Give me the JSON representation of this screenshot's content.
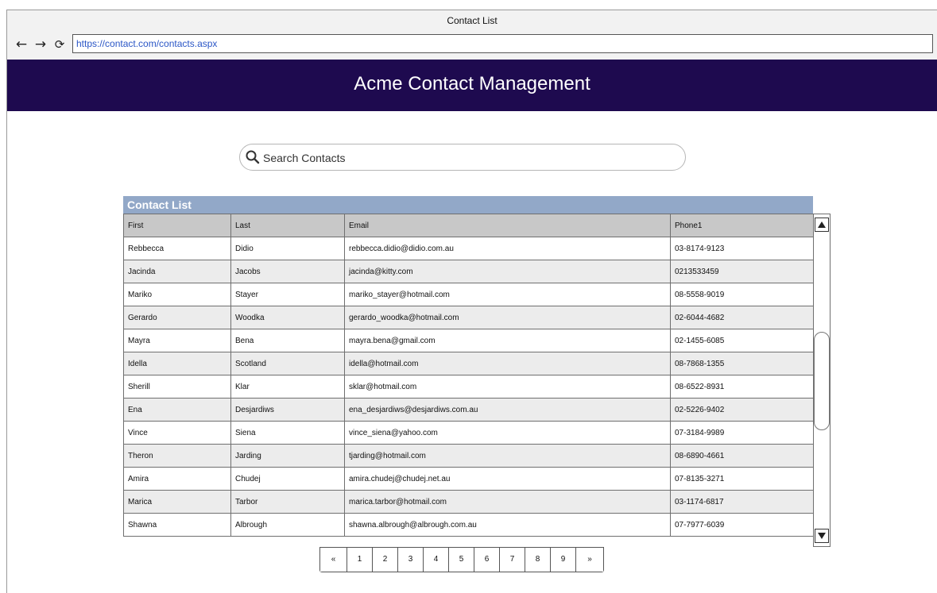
{
  "window": {
    "title": "Contact List",
    "url": "https://contact.com/contacts.aspx",
    "nav": {
      "back_icon": "back-arrow-icon",
      "forward_icon": "forward-arrow-icon",
      "reload_icon": "reload-icon"
    }
  },
  "header": {
    "title": "Acme Contact Management",
    "background": "#1e0a4f"
  },
  "search": {
    "placeholder": "Search Contacts",
    "icon": "search-icon"
  },
  "contact_list": {
    "caption": "Contact List",
    "caption_color": "#92a8c8",
    "columns": [
      "First",
      "Last",
      "Email",
      "Phone1"
    ],
    "rows": [
      [
        "Rebbecca",
        "Didio",
        "rebbecca.didio@didio.com.au",
        "03-8174-9123"
      ],
      [
        "Jacinda",
        "Jacobs",
        "jacinda@kitty.com",
        "0213533459"
      ],
      [
        "Mariko",
        "Stayer",
        "mariko_stayer@hotmail.com",
        "08-5558-9019"
      ],
      [
        "Gerardo",
        "Woodka",
        "gerardo_woodka@hotmail.com",
        "02-6044-4682"
      ],
      [
        "Mayra",
        "Bena",
        "mayra.bena@gmail.com",
        "02-1455-6085"
      ],
      [
        "Idella",
        "Scotland",
        "idella@hotmail.com",
        "08-7868-1355"
      ],
      [
        "Sherill",
        "Klar",
        "sklar@hotmail.com",
        "08-6522-8931"
      ],
      [
        "Ena",
        "Desjardiws",
        "ena_desjardiws@desjardiws.com.au",
        "02-5226-9402"
      ],
      [
        "Vince",
        "Siena",
        "vince_siena@yahoo.com",
        "07-3184-9989"
      ],
      [
        "Theron",
        "Jarding",
        "tjarding@hotmail.com",
        "08-6890-4661"
      ],
      [
        "Amira",
        "Chudej",
        "amira.chudej@chudej.net.au",
        "07-8135-3271"
      ],
      [
        "Marica",
        "Tarbor",
        "marica.tarbor@hotmail.com",
        "03-1174-6817"
      ],
      [
        "Shawna",
        "Albrough",
        "shawna.albrough@albrough.com.au",
        "07-7977-6039"
      ]
    ]
  },
  "pagination": {
    "prev": "«",
    "pages": [
      "1",
      "2",
      "3",
      "4",
      "5",
      "6",
      "7",
      "8",
      "9"
    ],
    "next": "»"
  }
}
